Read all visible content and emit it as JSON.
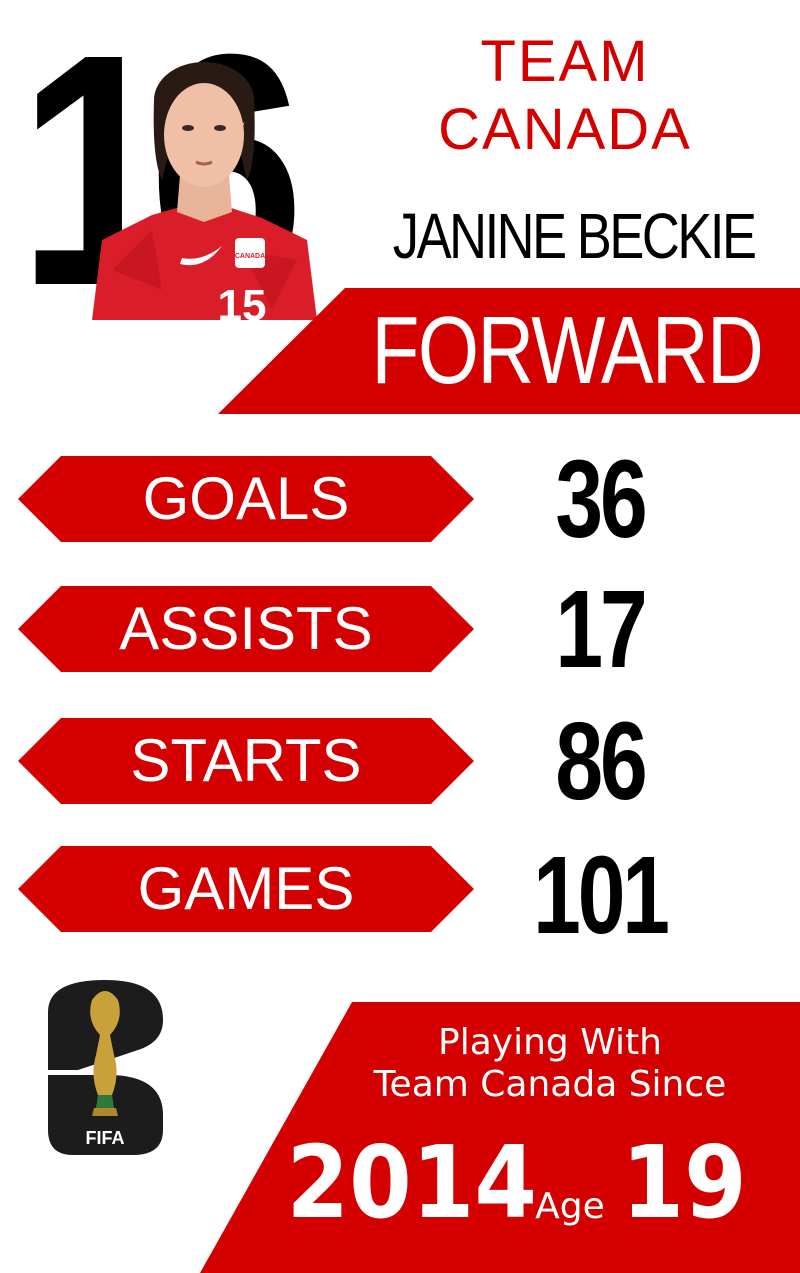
{
  "player": {
    "number": "16",
    "team": "TEAM CANADA",
    "name": "JANINE BECKIE",
    "position": "FORWARD",
    "photo_jersey_number": "15",
    "photo_crest_text": "CANADA"
  },
  "stats": [
    {
      "label": "GOALS",
      "value": "36"
    },
    {
      "label": "ASSISTS",
      "value": "17"
    },
    {
      "label": "STARTS",
      "value": "86"
    },
    {
      "label": "GAMES",
      "value": "101"
    }
  ],
  "logo": {
    "icon": "fifa-world-cup-2026-logo",
    "text": "FIFA"
  },
  "career": {
    "since_label_line1": "Playing With",
    "since_label_line2": "Team Canada Since",
    "since_year": "2014",
    "age_label": "Age",
    "age_value": "19"
  },
  "colors": {
    "accent_red": "#d40000",
    "text_black": "#000000",
    "background": "#ffffff",
    "logo_dark": "#1c1c1c"
  }
}
